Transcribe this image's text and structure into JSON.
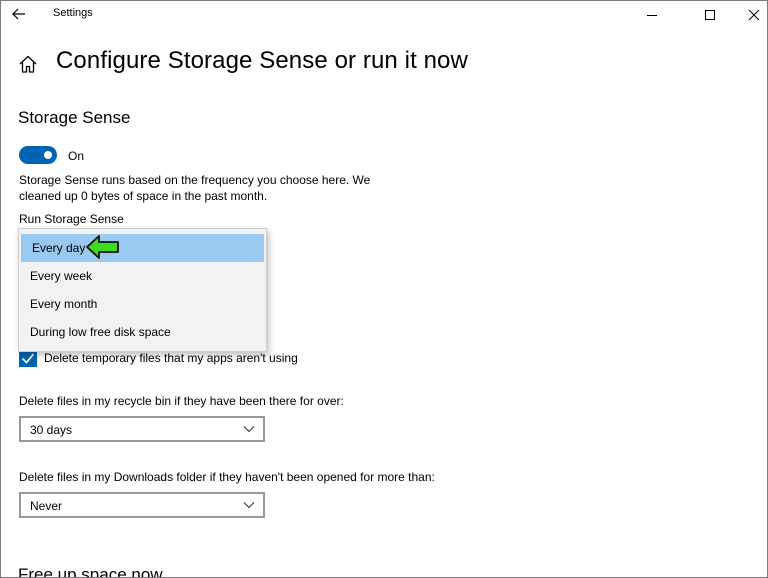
{
  "window": {
    "title": "Settings",
    "controls": {
      "minimize": "minimize",
      "maximize": "maximize",
      "close": "close"
    }
  },
  "page": {
    "title": "Configure Storage Sense or run it now"
  },
  "storage_sense": {
    "section_title": "Storage Sense",
    "toggle_state": "On",
    "toggle_on": true,
    "description": "Storage Sense runs based on the frequency you choose here. We cleaned up 0 bytes of space in the past month.",
    "run_label": "Run Storage Sense",
    "run_options": [
      "Every day",
      "Every week",
      "Every month",
      "During low free disk space"
    ],
    "run_selected": "Every day"
  },
  "temporary_files": {
    "checkbox_label": "Delete temporary files that my apps aren't using",
    "checked": true
  },
  "recycle_bin": {
    "label": "Delete files in my recycle bin if they have been there for over:",
    "value": "30 days"
  },
  "downloads": {
    "label": "Delete files in my Downloads folder if they haven't been opened for more than:",
    "value": "Never"
  },
  "free_up": {
    "section_title": "Free up space now"
  },
  "colors": {
    "accent": "#0063b1",
    "selected_option": "#99c9ef",
    "annotation_arrow": "#3ddc1f"
  }
}
